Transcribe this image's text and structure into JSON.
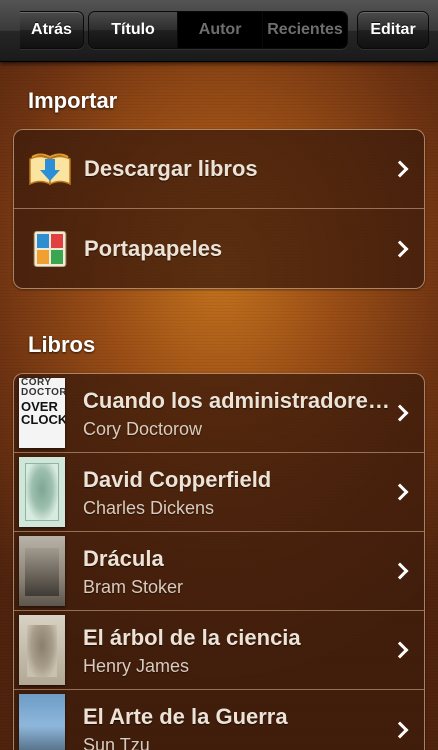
{
  "nav": {
    "back_label": "Atrás",
    "segments": [
      {
        "label": "Título",
        "selected": true
      },
      {
        "label": "Autor",
        "selected": false
      },
      {
        "label": "Recientes",
        "selected": false
      }
    ],
    "edit_label": "Editar"
  },
  "import": {
    "title": "Importar",
    "items": [
      {
        "label": "Descargar libros",
        "icon": "download-book-icon"
      },
      {
        "label": "Portapapeles",
        "icon": "clipboard-icon"
      }
    ]
  },
  "books": {
    "title": "Libros",
    "items": [
      {
        "title": "Cuando los administradores gobiernan la tierra",
        "author": "Cory Doctorow",
        "cover_text_top": "CORY DOCTOROW",
        "cover_text_mid": "OVER CLOCKED"
      },
      {
        "title": "David Copperfield",
        "author": "Charles Dickens"
      },
      {
        "title": "Drácula",
        "author": "Bram Stoker"
      },
      {
        "title": "El árbol de la ciencia",
        "author": "Henry James"
      },
      {
        "title": "El Arte de la Guerra",
        "author": "Sun Tzu"
      }
    ]
  },
  "colors": {
    "background_center": "#c4731d",
    "background_edge": "#4f230e",
    "row_text": "#ece2d6",
    "author_text": "#d9cbbd",
    "separator": "#cda582"
  }
}
